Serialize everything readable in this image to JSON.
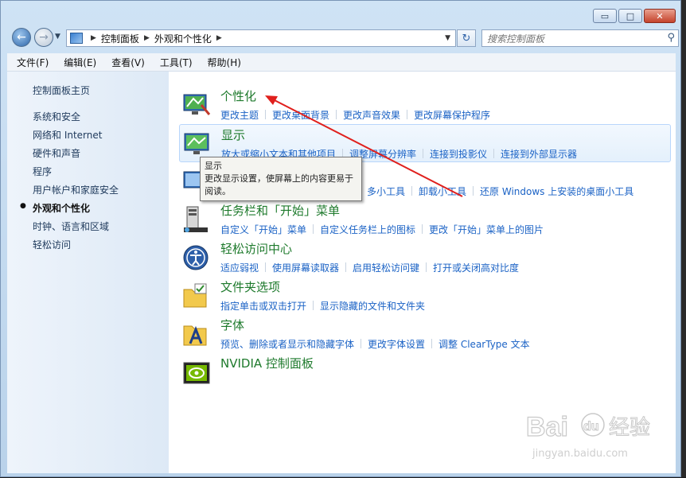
{
  "window": {
    "caption_buttons": {
      "minimize": "▭",
      "maximize": "□",
      "close": "✕"
    }
  },
  "address": {
    "breadcrumbs": [
      "控制面板",
      "外观和个性化"
    ],
    "search_placeholder": "搜索控制面板"
  },
  "menu": [
    "文件(F)",
    "编辑(E)",
    "查看(V)",
    "工具(T)",
    "帮助(H)"
  ],
  "sidebar": {
    "home": "控制面板主页",
    "items": [
      "系统和安全",
      "网络和 Internet",
      "硬件和声音",
      "程序",
      "用户帐户和家庭安全",
      "外观和个性化",
      "时钟、语言和区域",
      "轻松访问"
    ],
    "active_index": 5
  },
  "categories": [
    {
      "title": "个性化",
      "icon": "personalization-icon",
      "links": [
        "更改主题",
        "更改桌面背景",
        "更改声音效果",
        "更改屏幕保护程序"
      ]
    },
    {
      "title": "显示",
      "icon": "display-icon",
      "links": [
        "放大或缩小文本和其他项目",
        "调整屏幕分辨率",
        "连接到投影仪",
        "连接到外部显示器"
      ]
    },
    {
      "title": "",
      "icon": "desktop-gadgets-icon",
      "links": [
        "多小工具",
        "卸载小工具",
        "还原 Windows 上安装的桌面小工具"
      ]
    },
    {
      "title": "任务栏和「开始」菜单",
      "icon": "taskbar-icon",
      "links": [
        "自定义「开始」菜单",
        "自定义任务栏上的图标",
        "更改「开始」菜单上的图片"
      ]
    },
    {
      "title": "轻松访问中心",
      "icon": "ease-of-access-icon",
      "links": [
        "适应弱视",
        "使用屏幕读取器",
        "启用轻松访问键",
        "打开或关闭高对比度"
      ]
    },
    {
      "title": "文件夹选项",
      "icon": "folder-options-icon",
      "links": [
        "指定单击或双击打开",
        "显示隐藏的文件和文件夹"
      ]
    },
    {
      "title": "字体",
      "icon": "fonts-icon",
      "links": [
        "预览、删除或者显示和隐藏字体",
        "更改字体设置",
        "调整 ClearType 文本"
      ]
    },
    {
      "title": "NVIDIA 控制面板",
      "icon": "nvidia-icon",
      "links": []
    }
  ],
  "tooltip": {
    "title": "显示",
    "body": "更改显示设置，使屏幕上的内容更易于阅读。"
  },
  "watermark": {
    "brand": "Bai",
    "cn": "经验",
    "url": "jingyan.baidu.com"
  },
  "colors": {
    "title_green": "#1e7a2c",
    "link_blue": "#1a62c5",
    "arrow_red": "#e0201d"
  }
}
